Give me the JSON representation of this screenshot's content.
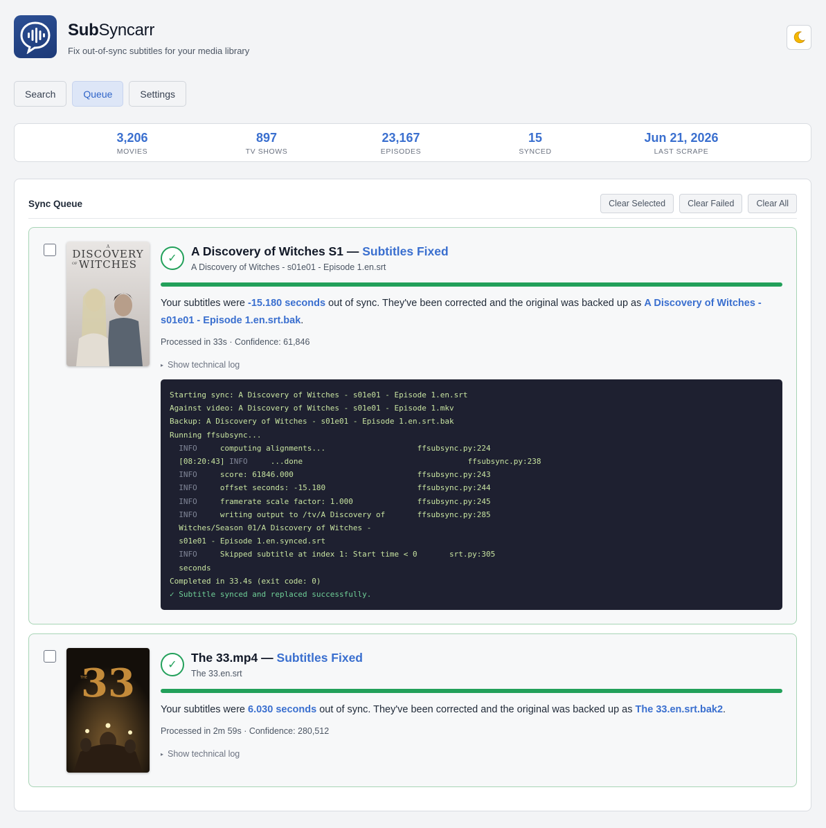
{
  "app": {
    "title_bold": "Sub",
    "title_rest": "Syncarr",
    "subtitle": "Fix out-of-sync subtitles for your media library",
    "theme_icon": "moon-icon"
  },
  "tabs": [
    {
      "label": "Search",
      "active": false
    },
    {
      "label": "Queue",
      "active": true
    },
    {
      "label": "Settings",
      "active": false
    }
  ],
  "stats": [
    {
      "value": "3,206",
      "label": "MOVIES"
    },
    {
      "value": "897",
      "label": "TV SHOWS"
    },
    {
      "value": "23,167",
      "label": "EPISODES"
    },
    {
      "value": "15",
      "label": "SYNCED"
    },
    {
      "value": "Jun 21, 2026",
      "label": "LAST SCRAPE"
    }
  ],
  "queue": {
    "title": "Sync Queue",
    "actions": [
      "Clear Selected",
      "Clear Failed",
      "Clear All"
    ],
    "items": [
      {
        "name": "A Discovery of Witches S1",
        "sep": " — ",
        "status": "Subtitles Fixed",
        "file": "A Discovery of Witches - s01e01 - Episode 1.en.srt",
        "msg_pre": "Your subtitles were ",
        "offset": "-15.180 seconds",
        "msg_mid": " out of sync. They've been corrected and the original was backed up as ",
        "backup": "A Discovery of Witches - s01e01 - Episode 1.en.srt.bak",
        "msg_post": ".",
        "meta": "Processed in 33s · Confidence: 61,846",
        "log_toggle": "Show technical log",
        "progress": 1.0,
        "log": [
          "Starting sync: A Discovery of Witches - s01e01 - Episode 1.en.srt",
          "Against video: A Discovery of Witches - s01e01 - Episode 1.mkv",
          "Backup: A Discovery of Witches - s01e01 - Episode 1.en.srt.bak",
          "Running ffsubsync...",
          "  INFO     computing alignments...                    ffsubsync.py:224",
          "  [08:20:43] INFO     ...done                                    ffsubsync.py:238",
          "  INFO     score: 61846.000                           ffsubsync.py:243",
          "  INFO     offset seconds: -15.180                    ffsubsync.py:244",
          "  INFO     framerate scale factor: 1.000              ffsubsync.py:245",
          "  INFO     writing output to /tv/A Discovery of       ffsubsync.py:285",
          "  Witches/Season 01/A Discovery of Witches -",
          "  s01e01 - Episode 1.en.synced.srt",
          "  INFO     Skipped subtitle at index 1: Start time < 0       srt.py:305",
          "  seconds",
          "Completed in 33.4s (exit code: 0)",
          "✓ Subtitle synced and replaced successfully."
        ]
      },
      {
        "name": "The 33.mp4",
        "sep": " — ",
        "status": "Subtitles Fixed",
        "file": "The 33.en.srt",
        "msg_pre": "Your subtitles were ",
        "offset": "6.030 seconds",
        "msg_mid": " out of sync. They've been corrected and the original was backed up as ",
        "backup": "The 33.en.srt.bak2",
        "msg_post": ".",
        "meta": "Processed in 2m 59s · Confidence: 280,512",
        "log_toggle": "Show technical log",
        "progress": 1.0
      }
    ]
  }
}
